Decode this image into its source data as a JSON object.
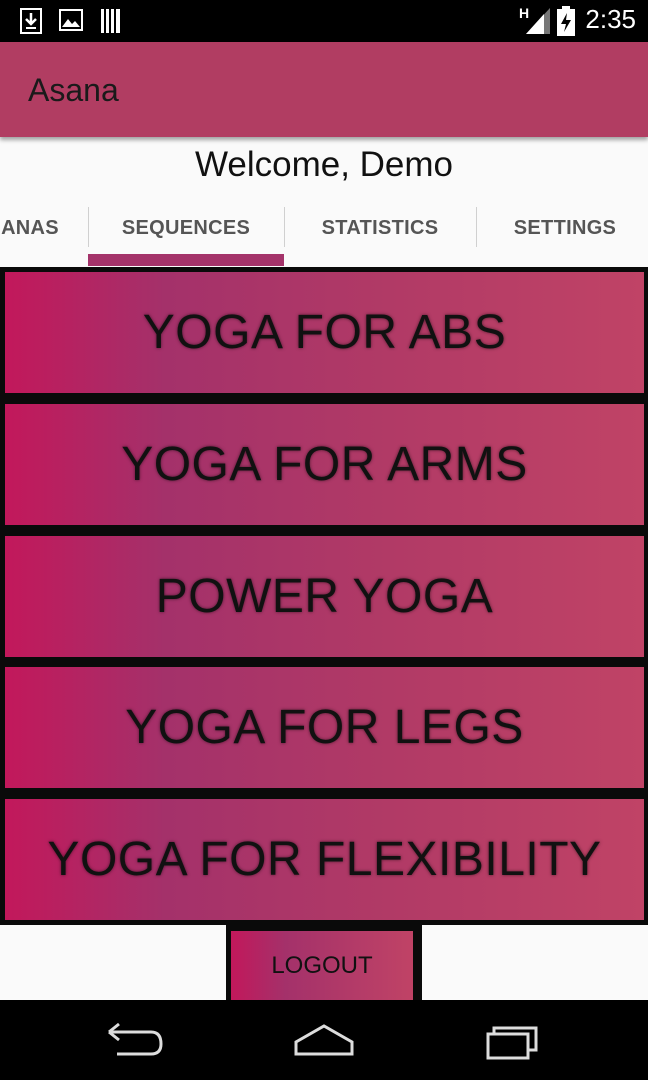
{
  "status_bar": {
    "time": "2:35",
    "network_label": "H",
    "icons": [
      "download-icon",
      "image-icon",
      "barcode-icon",
      "signal-icon",
      "battery-charging-icon"
    ]
  },
  "action_bar": {
    "title": "Asana"
  },
  "welcome_text": "Welcome, Demo",
  "tabs": [
    {
      "label": "ANAS",
      "selected": false
    },
    {
      "label": "SEQUENCES",
      "selected": true
    },
    {
      "label": "STATISTICS",
      "selected": false
    },
    {
      "label": "SETTINGS",
      "selected": false
    }
  ],
  "sequences": [
    {
      "label": "YOGA FOR ABS"
    },
    {
      "label": "YOGA FOR ARMS"
    },
    {
      "label": "POWER YOGA"
    },
    {
      "label": "YOGA FOR LEGS"
    },
    {
      "label": "YOGA FOR FLEXIBILITY"
    }
  ],
  "logout_label": "LOGOUT",
  "nav_bar": {
    "icons": [
      "back-icon",
      "home-icon",
      "recents-icon"
    ]
  },
  "colors": {
    "accent": "#b13d62",
    "indicator": "#a4336a",
    "button_start": "#c2185b",
    "button_end": "#c04366"
  }
}
